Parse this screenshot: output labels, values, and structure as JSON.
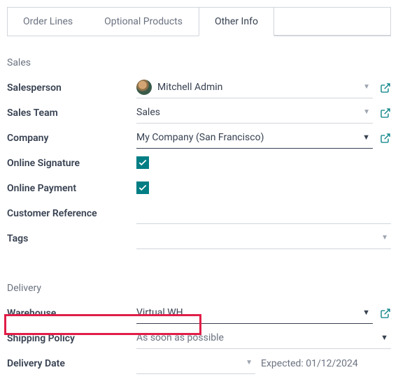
{
  "tabs": {
    "order_lines": "Order Lines",
    "optional_products": "Optional Products",
    "other_info": "Other Info"
  },
  "sections": {
    "sales": {
      "title": "Sales",
      "salesperson": {
        "label": "Salesperson",
        "value": "Mitchell Admin"
      },
      "sales_team": {
        "label": "Sales Team",
        "value": "Sales"
      },
      "company": {
        "label": "Company",
        "value": "My Company (San Francisco)"
      },
      "online_signature": {
        "label": "Online Signature",
        "checked": true
      },
      "online_payment": {
        "label": "Online Payment",
        "checked": true
      },
      "customer_reference": {
        "label": "Customer Reference",
        "value": ""
      },
      "tags": {
        "label": "Tags",
        "value": ""
      }
    },
    "delivery": {
      "title": "Delivery",
      "warehouse": {
        "label": "Warehouse",
        "value": "Virtual WH"
      },
      "shipping_policy": {
        "label": "Shipping Policy",
        "value": "As soon as possible"
      },
      "delivery_date": {
        "label": "Delivery Date",
        "value": "",
        "expected": "Expected: 01/12/2024"
      }
    }
  }
}
